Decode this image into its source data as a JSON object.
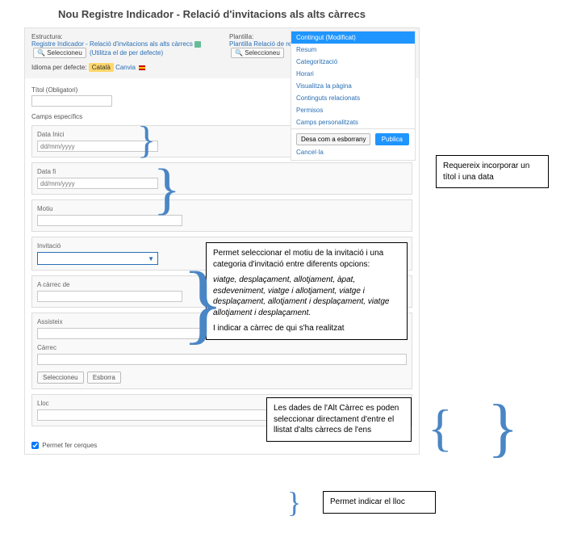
{
  "page_title": "Nou Registre Indicador - Relació d'invitacions als alts càrrecs",
  "info": {
    "estructura_label": "Estructura:",
    "estructura_text": "Registre Indicador - Relació d'invitacions als alts càrrecs",
    "seleccioneu": "Seleccioneu",
    "utilitza": "(Utilitza el de per defecte)",
    "plantilla_label": "Plantilla:",
    "plantilla_text": "Plantilla Relació de regals, invitacions i viatges - Invitacions",
    "idioma_label": "Idioma per defecte:",
    "idioma_value": "Català",
    "canvia": "Canvia"
  },
  "form": {
    "titol_label": "Títol (Obligatori)",
    "camps_label": "Camps específics",
    "data_inici": "Data Inici",
    "data_fi": "Data fi",
    "placeholder_date": "dd/mm/yyyy",
    "motiu": "Motiu",
    "invitacio": "Invitació",
    "acarrec": "A càrrec de",
    "assisteix": "Assisteix",
    "carrec": "Càrrec",
    "btn_seleccioneu": "Seleccioneu",
    "btn_esborra": "Esborra",
    "lloc": "Lloc",
    "permet_cerques": "Permet fer cerques"
  },
  "side": {
    "contingut": "Contingut (Modificat)",
    "resum": "Resum",
    "categoritzacio": "Categorització",
    "horari": "Horari",
    "visualitza": "Visualitza la pàgina",
    "relacionats": "Continguts relacionats",
    "permisos": "Permisos",
    "camps": "Camps personalitzats",
    "desa": "Desa com a esborrany",
    "publica": "Publica",
    "cancel": "Cancel·la"
  },
  "annot": {
    "a1": "Requereix incorporar un  títol i una data",
    "a2_l1": "Permet  seleccionar el motiu de la invitació i una categoria d'invitació entre diferents opcions:",
    "a2_l2": "viatge, desplaçament, allotjament, àpat, esdeveniment, viatge i allotjament, viatge i desplaçament, allotjament i desplaçament, viatge allotjament i desplaçament.",
    "a2_l3": "I indicar a càrrec de qui s'ha realitzat",
    "a3": "Les dades de l'Alt Càrrec es poden seleccionar directament d'entre el llistat d'alts càrrecs de l'ens",
    "a4": "Permet indicar el lloc"
  }
}
